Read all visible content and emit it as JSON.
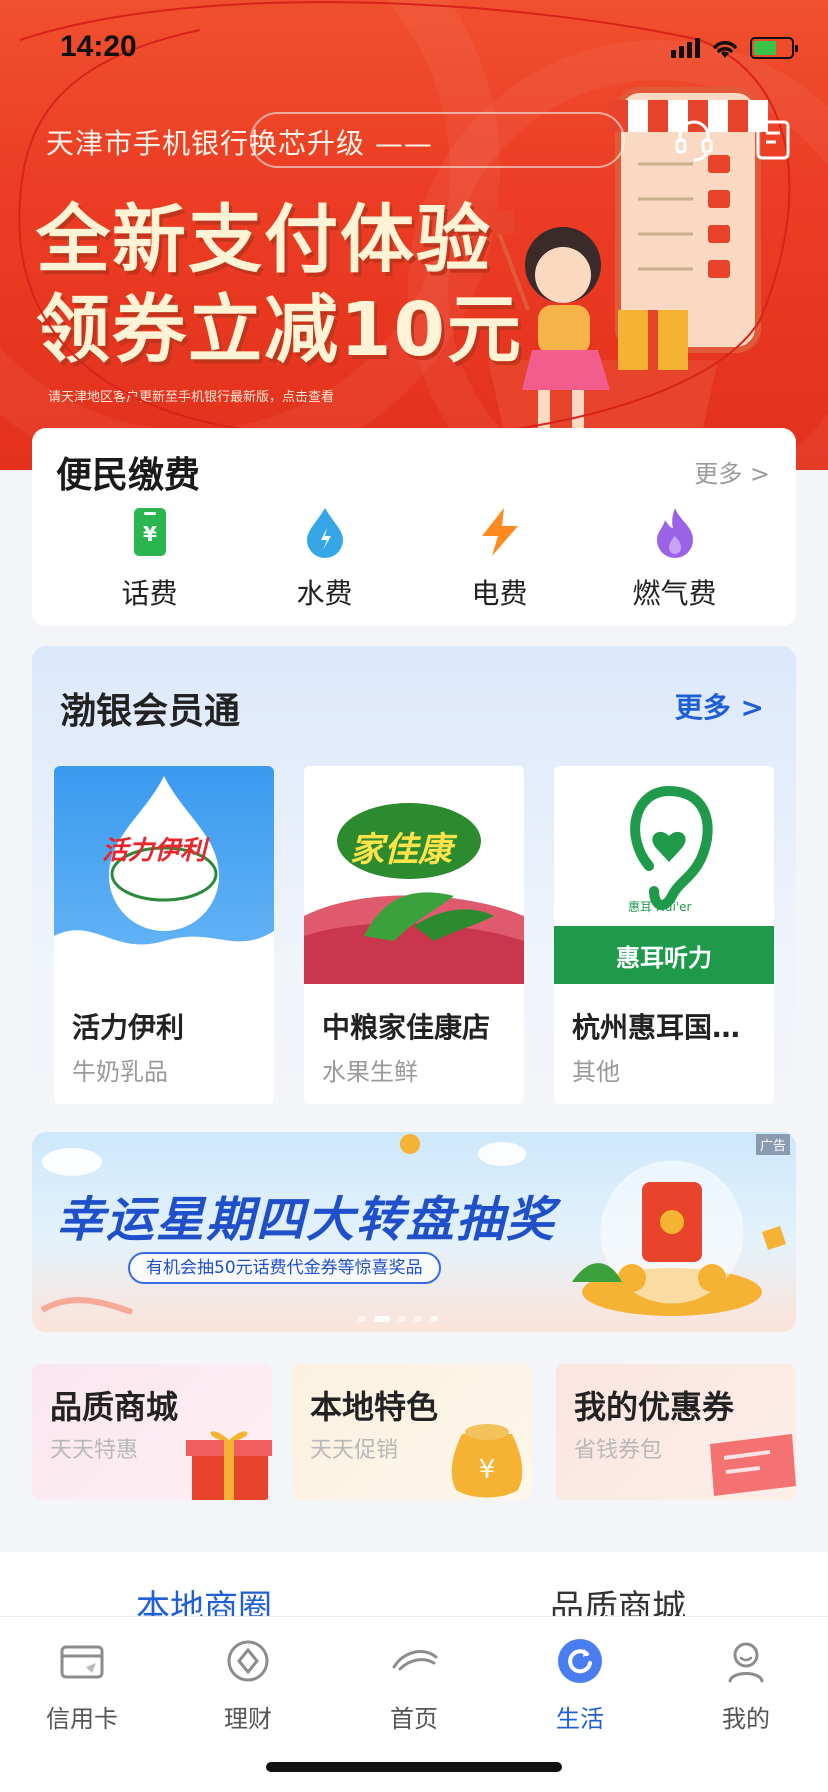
{
  "status_bar": {
    "time": "14:20"
  },
  "hero": {
    "subtitle": "天津市手机银行换芯升级 ——",
    "title_line1": "全新支付体验",
    "title_line2": "领券立减10元",
    "note": "请天津地区客户更新至手机银行最新版，点击查看",
    "icons": [
      "headset-icon",
      "menu-icon"
    ]
  },
  "payments": {
    "title": "便民缴费",
    "more": "更多 >",
    "items": [
      {
        "label": "话费",
        "icon": "phone-bill-icon",
        "color": "#2bb54f"
      },
      {
        "label": "水费",
        "icon": "water-drop-icon",
        "color": "#35a7e6"
      },
      {
        "label": "电费",
        "icon": "lightning-icon",
        "color": "#ff8a1f"
      },
      {
        "label": "燃气费",
        "icon": "flame-icon",
        "color": "#9a62e6"
      }
    ]
  },
  "member": {
    "title": "渤银会员通",
    "more": "更多 >",
    "merchants": [
      {
        "name": "活力伊利",
        "category": "牛奶乳品",
        "logo": "活力伊利"
      },
      {
        "name": "中粮家佳康店",
        "category": "水果生鲜",
        "logo": "家佳康"
      },
      {
        "name": "杭州惠耳国…",
        "category": "其他",
        "logo": "惠耳听力",
        "logo_sub": "惠耳 Hui'er"
      }
    ]
  },
  "ad": {
    "tag": "广告",
    "title": "幸运星期四大转盘抽奖",
    "subtitle": "有机会抽50元话费代金券等惊喜奖品",
    "dots": 5,
    "active_dot": 1
  },
  "tiles": [
    {
      "title": "品质商城",
      "subtitle": "天天特惠"
    },
    {
      "title": "本地特色",
      "subtitle": "天天促销"
    },
    {
      "title": "我的优惠券",
      "subtitle": "省钱券包"
    }
  ],
  "tabs": [
    {
      "label": "本地商圈",
      "active": true
    },
    {
      "label": "品质商城",
      "active": false
    }
  ],
  "bottom_nav": [
    {
      "label": "信用卡",
      "icon": "credit-card-icon",
      "active": false
    },
    {
      "label": "理财",
      "icon": "wealth-icon",
      "active": false
    },
    {
      "label": "首页",
      "icon": "home-icon",
      "active": false
    },
    {
      "label": "生活",
      "icon": "life-icon",
      "active": true
    },
    {
      "label": "我的",
      "icon": "profile-icon",
      "active": false
    }
  ],
  "colors": {
    "accent_blue": "#1f5fd6",
    "hero_red": "#ec3d24",
    "hero_text": "#fff3d6"
  }
}
